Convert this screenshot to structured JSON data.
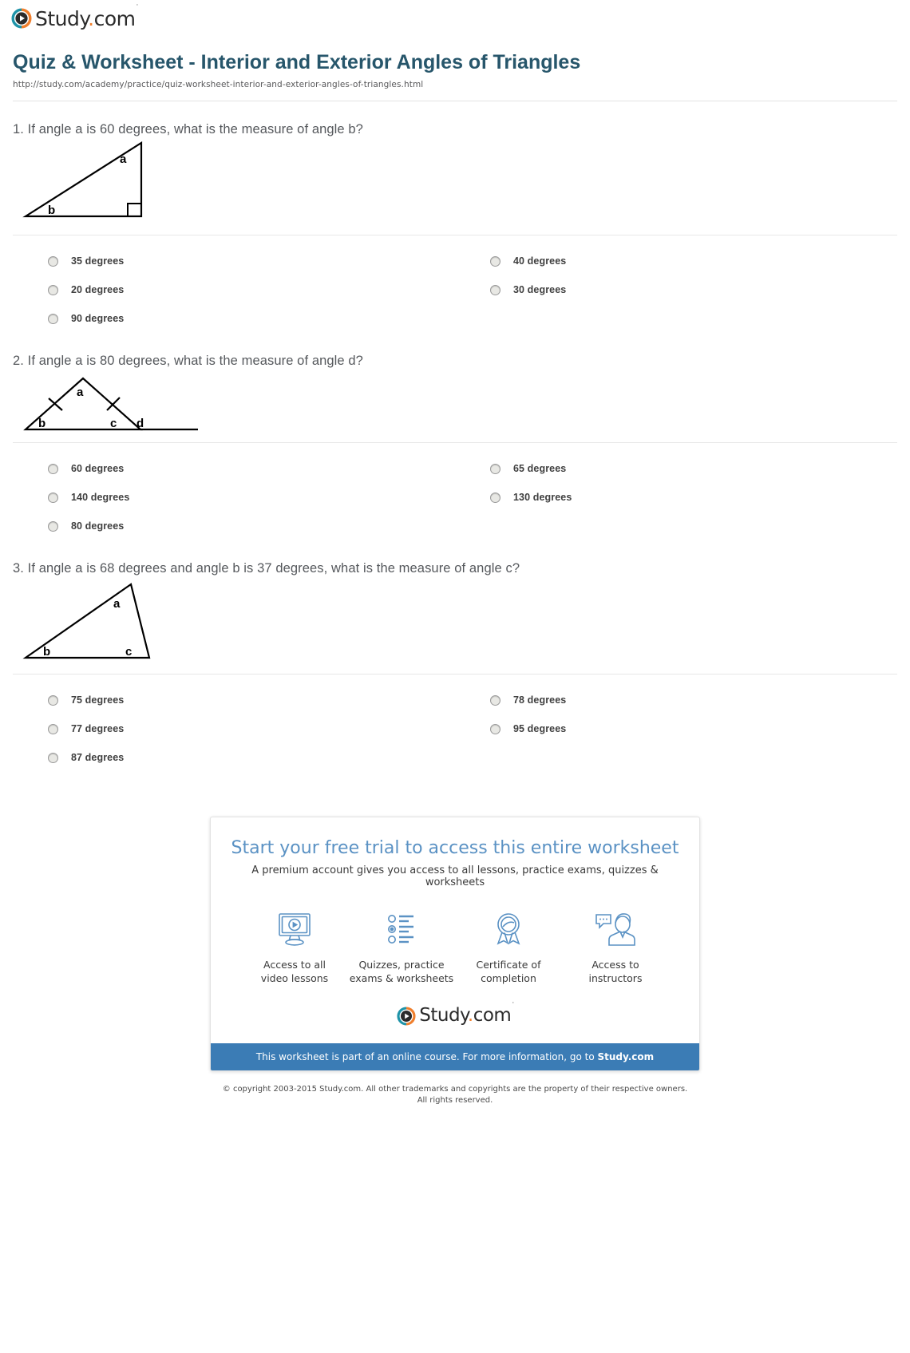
{
  "brand": {
    "name_before_dot": "Study",
    "dot": ".",
    "name_after_dot": "com",
    "tm": "·",
    "colors": {
      "teal": "#1e93a8",
      "orange": "#f07f2d",
      "title": "#27566b",
      "promo_blue": "#3b7cb5"
    }
  },
  "header": {
    "title": "Quiz & Worksheet - Interior and Exterior Angles of Triangles",
    "url": "http://study.com/academy/practice/quiz-worksheet-interior-and-exterior-angles-of-triangles.html"
  },
  "questions": [
    {
      "number": "1.",
      "text": "1. If angle a is 60 degrees, what is the measure of angle b?",
      "figure": {
        "type": "right-triangle",
        "labels": [
          "a",
          "b"
        ],
        "right_angle_marker": true
      },
      "answers": [
        {
          "label": "35 degrees"
        },
        {
          "label": "40 degrees"
        },
        {
          "label": "20 degrees"
        },
        {
          "label": "30 degrees"
        },
        {
          "label": "90 degrees"
        }
      ]
    },
    {
      "number": "2.",
      "text": "2. If angle a is 80 degrees, what is the measure of angle d?",
      "figure": {
        "type": "isosceles-triangle-with-exterior-angle",
        "labels": [
          "a",
          "b",
          "c",
          "d"
        ],
        "tick_marks": 2
      },
      "answers": [
        {
          "label": "60 degrees"
        },
        {
          "label": "65 degrees"
        },
        {
          "label": "140 degrees"
        },
        {
          "label": "130 degrees"
        },
        {
          "label": "80 degrees"
        }
      ]
    },
    {
      "number": "3.",
      "text": "3. If angle a is 68 degrees and angle b is 37 degrees, what is the measure of angle c?",
      "figure": {
        "type": "scalene-triangle",
        "labels": [
          "a",
          "b",
          "c"
        ]
      },
      "answers": [
        {
          "label": "75 degrees"
        },
        {
          "label": "78 degrees"
        },
        {
          "label": "77 degrees"
        },
        {
          "label": "95 degrees"
        },
        {
          "label": "87 degrees"
        }
      ]
    }
  ],
  "promo": {
    "title": "Start your free trial to access this entire worksheet",
    "subtitle": "A premium account gives you access to all lessons, practice exams, quizzes & worksheets",
    "features": [
      {
        "icon": "video-monitor-icon",
        "line1": "Access to all",
        "line2": "video lessons"
      },
      {
        "icon": "checklist-icon",
        "line1": "Quizzes, practice",
        "line2": "exams & worksheets"
      },
      {
        "icon": "award-ribbon-icon",
        "line1": "Certificate of",
        "line2": "completion"
      },
      {
        "icon": "instructor-chat-icon",
        "line1": "Access to",
        "line2": "instructors"
      }
    ],
    "bar_text_before": "This worksheet is part of an online course. For more information, go to ",
    "bar_link": "Study.com"
  },
  "footer": {
    "line1": "© copyright 2003-2015 Study.com. All other trademarks and copyrights are the property of their respective owners.",
    "line2": "All rights reserved."
  }
}
